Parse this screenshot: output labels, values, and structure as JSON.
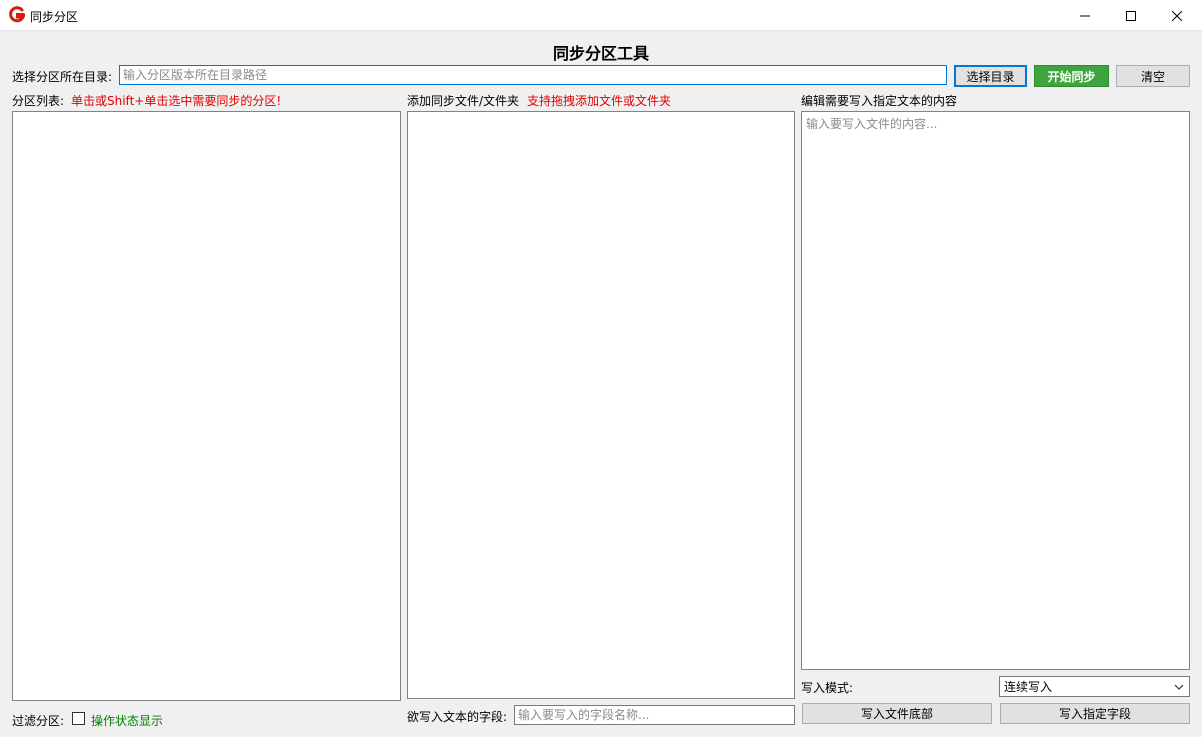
{
  "window": {
    "title": "同步分区",
    "logo_icon": "g-logo-icon",
    "controls": [
      "minimize-icon",
      "maximize-icon",
      "close-icon"
    ]
  },
  "heading": "同步分区工具",
  "directory": {
    "label": "选择分区所在目录:",
    "placeholder": "输入分区版本所在目录路径",
    "value": "",
    "select_button": "选择目录",
    "start_button": "开始同步",
    "clear_button": "清空"
  },
  "partition_list": {
    "label": "分区列表:",
    "hint": "单击或Shift+单击选中需要同步的分区!"
  },
  "sync_files": {
    "label": "添加同步文件/文件夹",
    "hint": "支持拖拽添加文件或文件夹"
  },
  "content_editor": {
    "label": "编辑需要写入指定文本的内容",
    "placeholder": "输入要写入文件的内容..."
  },
  "filter": {
    "label": "过滤分区:",
    "status_label": "操作状态显示",
    "checked": false
  },
  "field": {
    "label": "欲写入文本的字段:",
    "placeholder": "输入要写入的字段名称..."
  },
  "write_mode": {
    "label": "写入模式:",
    "selected": "连续写入"
  },
  "actions": {
    "write_bottom": "写入文件底部",
    "write_field": "写入指定字段"
  },
  "colors": {
    "accent": "#0078d7",
    "start_green": "#3da53d",
    "hint_red": "#e00000",
    "status_green": "#008000",
    "logo_red": "#d81e06"
  }
}
